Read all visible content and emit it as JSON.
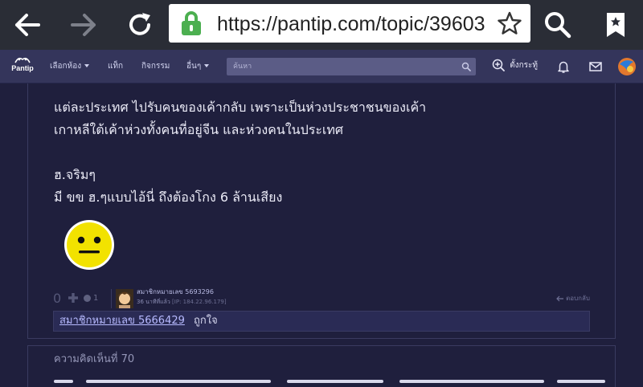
{
  "browser": {
    "url": "https://pantip.com/topic/39603",
    "icons": [
      "back-arrow-icon",
      "forward-arrow-icon",
      "reload-icon",
      "lock-icon",
      "star-icon",
      "search-icon",
      "bookmark-icon"
    ],
    "accent_color": "#4caf50"
  },
  "site_nav": {
    "logo_text": "Pantip",
    "items": [
      {
        "label": "เลือกห้อง",
        "dropdown": true
      },
      {
        "label": "แท็ก",
        "dropdown": false
      },
      {
        "label": "กิจกรรม",
        "dropdown": false
      },
      {
        "label": "อื่นๆ",
        "dropdown": true
      }
    ],
    "search_placeholder": "ค้นหา",
    "new_topic_label": "ตั้งกระทู้",
    "icons": [
      "search-icon",
      "new-topic-icon",
      "notification-bell-icon",
      "mail-icon",
      "user-avatar-icon"
    ],
    "bar_color": "#34355b"
  },
  "post": {
    "lines": [
      "แต่ละประเทศ ไปรับคนของเค้ากลับ เพราะเป็นห่วงประชาชนของเค้า",
      "เกาหลีใต้เค้าห่วงทั้งคนที่อยู่จีน และห่วงคนในประเทศ",
      "",
      "ฮ.จริมๆ",
      "มี ขข ฮ.ๆแบบไอ้นี่ ถึงต้องโกง 6 ล้านเสียง"
    ],
    "emoji": "neutral-face-emoji",
    "votes": "0",
    "emotion_count": "1",
    "author": "สมาชิกหมายเลข 5693296",
    "posted_time": "36 นาทีที่แล้ว",
    "ip": "[IP: 184.22.96.179]",
    "reply_label": "ตอบกลับ",
    "liked_by": "สมาชิกหมายเลข 5666429",
    "liked_label": "ถูกใจ"
  },
  "next_comment": {
    "title": "ความคิดเห็นที่ 70"
  }
}
